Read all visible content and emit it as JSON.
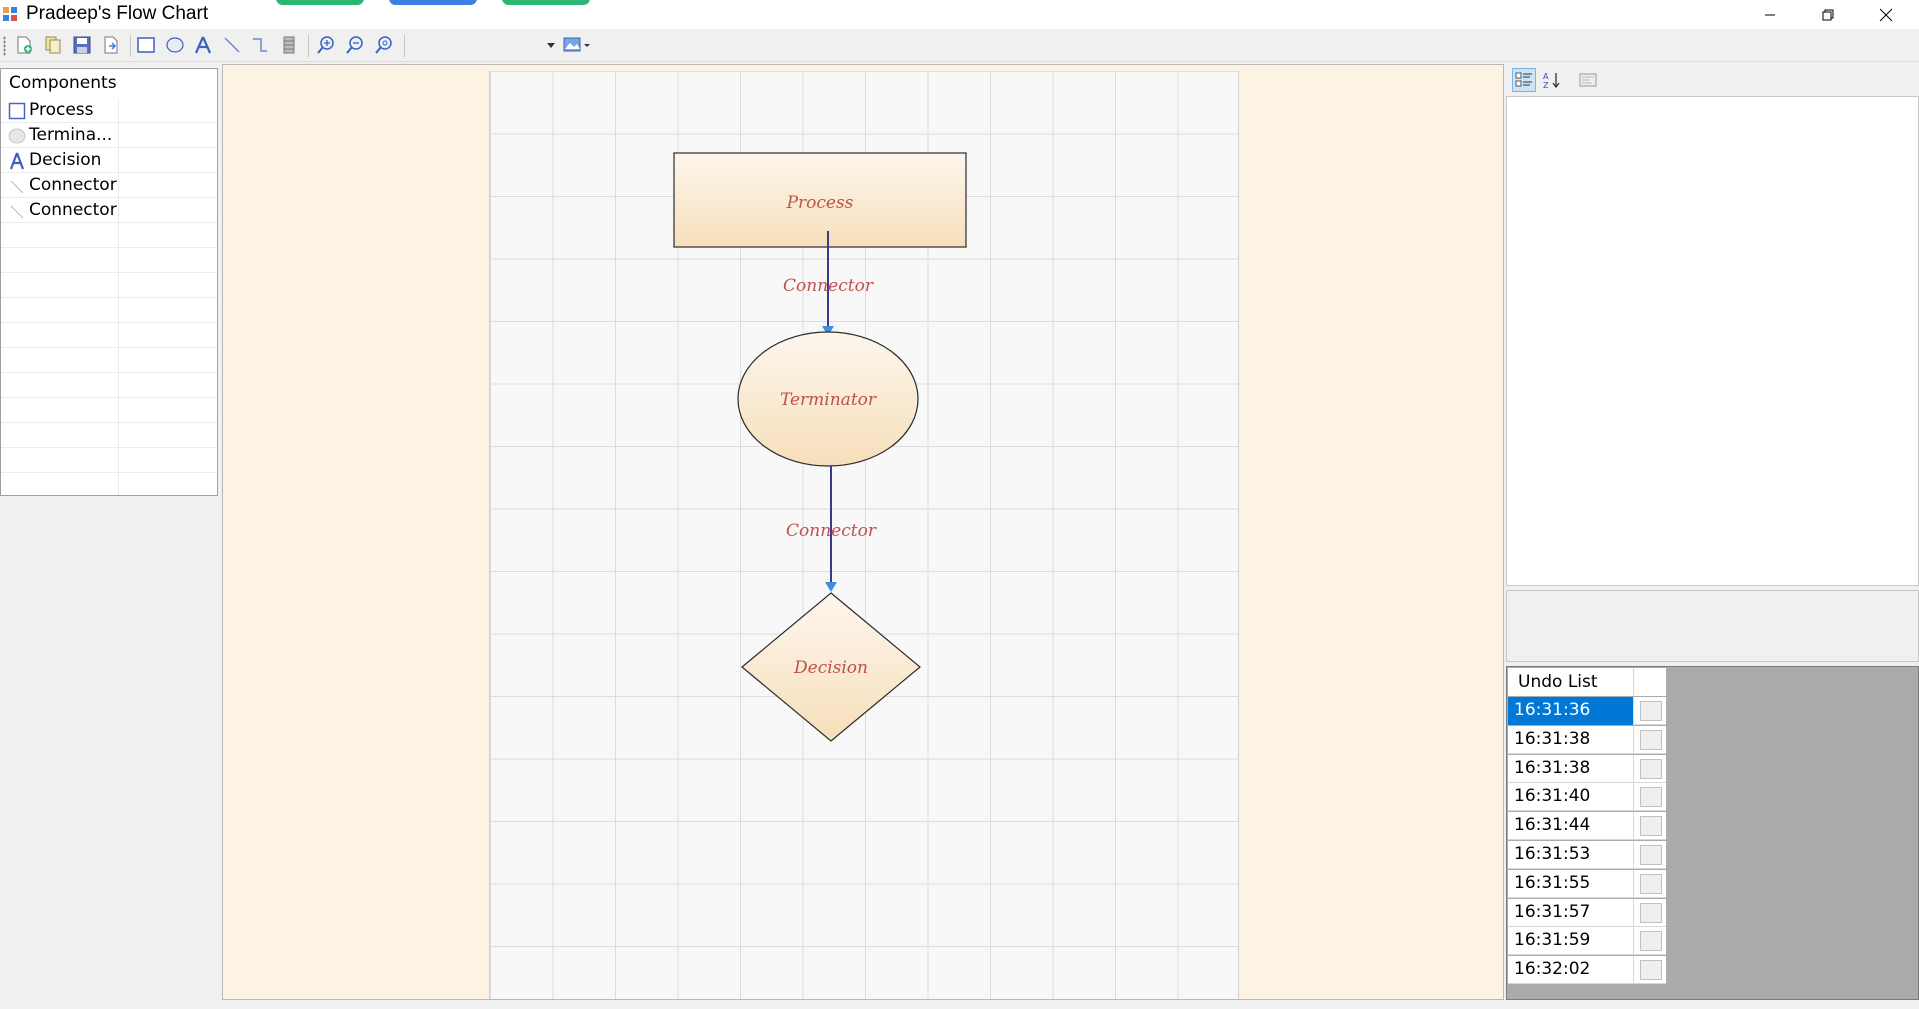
{
  "window": {
    "title": "Pradeep's Flow Chart"
  },
  "toolbar": {
    "buttons": [
      "new-file-icon",
      "copy-icon",
      "save-icon",
      "export-icon",
      "rectangle-icon",
      "ellipse-icon",
      "decision-shape-icon",
      "line-icon",
      "elbow-connector-icon",
      "grid-icon",
      "zoom-in-icon",
      "zoom-out-icon",
      "zoom-reset-icon",
      "image-dropdown-icon"
    ]
  },
  "components": {
    "header": "Components",
    "items": [
      {
        "label": "Process",
        "icon": "rectangle-icon"
      },
      {
        "label": "Termina...",
        "icon": "ellipse-icon"
      },
      {
        "label": "Decision",
        "icon": "decision-icon"
      },
      {
        "label": "Connector",
        "icon": "line-icon"
      },
      {
        "label": "Connector",
        "icon": "line-icon"
      }
    ]
  },
  "flowchart": {
    "process_label": "Process",
    "connector1_label": "Connector",
    "terminator_label": "Terminator",
    "connector2_label": "Connector",
    "decision_label": "Decision",
    "colors": {
      "shape_top": "#fdf6ee",
      "shape_bottom": "#f6dfba",
      "text": "#c0504d",
      "connector": "#3a3a8c",
      "arrow": "#3d8fe0"
    }
  },
  "undo_list": {
    "header": "Undo List",
    "items": [
      "16:31:36",
      "16:31:38",
      "16:31:38",
      "16:31:40",
      "16:31:44",
      "16:31:53",
      "16:31:55",
      "16:31:57",
      "16:31:59",
      "16:32:02"
    ],
    "selected_index": 0
  }
}
